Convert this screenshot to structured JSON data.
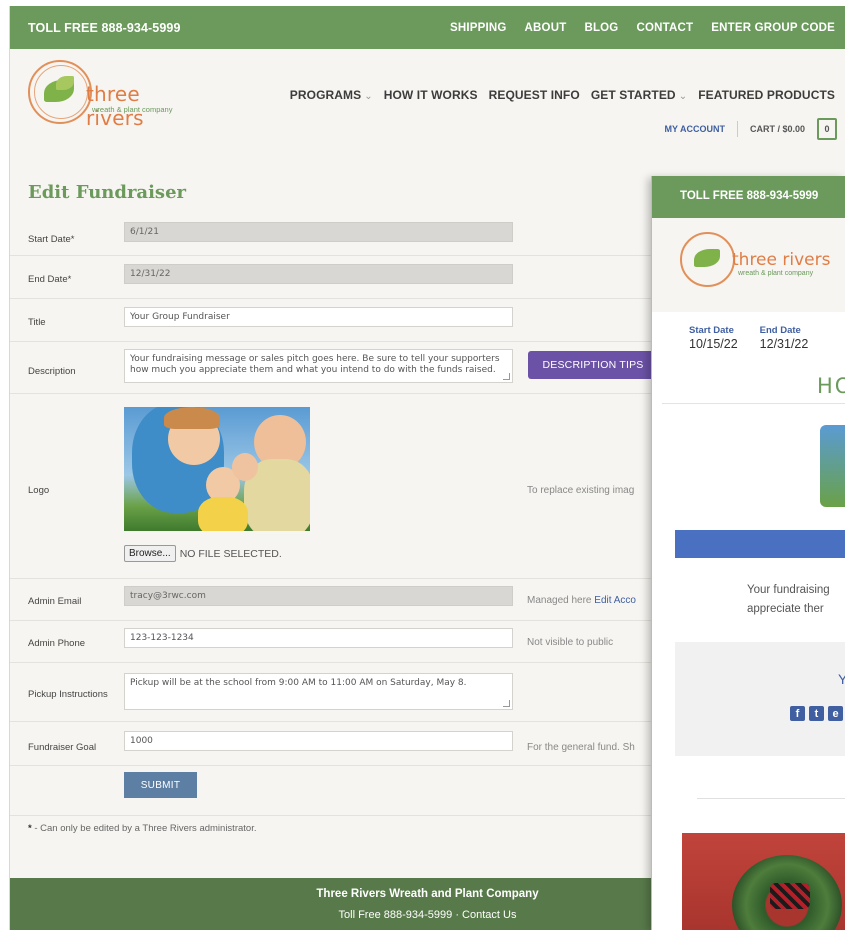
{
  "topbar": {
    "toll_free": "TOLL FREE 888-934-5999",
    "links": [
      "SHIPPING",
      "ABOUT",
      "BLOG",
      "CONTACT",
      "ENTER GROUP CODE"
    ]
  },
  "logo": {
    "name": "three rivers",
    "tagline": "wreath & plant company"
  },
  "nav": {
    "programs": "PROGRAMS",
    "how_it_works": "HOW IT WORKS",
    "request_info": "REQUEST INFO",
    "get_started": "GET STARTED",
    "featured_products": "FEATURED PRODUCTS",
    "chevron": "⌄"
  },
  "account": {
    "my_account": "MY ACCOUNT",
    "cart": "CART / $0.00",
    "cart_count": "0"
  },
  "form": {
    "title": "Edit Fundraiser",
    "start_date": {
      "label": "Start Date*",
      "value": "6/1/21"
    },
    "end_date": {
      "label": "End Date*",
      "value": "12/31/22"
    },
    "title_field": {
      "label": "Title",
      "value": "Your Group Fundraiser"
    },
    "description": {
      "label": "Description",
      "value": "Your fundraising message or sales pitch goes here. Be sure to tell your supporters how much you appreciate them and what you intend to do with the funds raised.",
      "tips_button": "DESCRIPTION TIPS"
    },
    "logo": {
      "label": "Logo",
      "hint": "To replace existing imag",
      "browse": "Browse...",
      "no_file": "NO FILE SELECTED."
    },
    "admin_email": {
      "label": "Admin Email",
      "value": "tracy@3rwc.com",
      "hint": "Managed here",
      "hint_link": "Edit Acco"
    },
    "admin_phone": {
      "label": "Admin Phone",
      "value": "123-123-1234",
      "hint": "Not visible to public"
    },
    "pickup": {
      "label": "Pickup Instructions",
      "value": "Pickup will be at the school from 9:00 AM to 11:00 AM on Saturday, May 8."
    },
    "goal": {
      "label": "Fundraiser Goal",
      "value": "1000",
      "hint": "For the general fund. Sh"
    },
    "submit": "SUBMIT",
    "footnote_star": "*",
    "footnote": " - Can only be edited by a Three Rivers administrator."
  },
  "footer": {
    "company": "Three Rivers Wreath and Plant Company",
    "toll_free": "Toll Free 888-934-5999",
    "separator": " · ",
    "contact": "Contact Us"
  },
  "preview": {
    "toll_free": "TOLL FREE 888-934-5999",
    "logo_name": "three rivers",
    "logo_tagline": "wreath & plant company",
    "start_date_label": "Start Date",
    "start_date": "10/15/22",
    "end_date_label": "End Date",
    "end_date": "12/31/22",
    "heading": "HO",
    "text_line1": "Your fundraising",
    "text_line2": "appreciate ther",
    "box_letter": "Y",
    "social": [
      "f",
      "t",
      "e"
    ]
  },
  "colors": {
    "green": "#6b9a5c",
    "purple": "#6b52a6",
    "blue": "#4a70c1",
    "orange": "#e07d45"
  }
}
